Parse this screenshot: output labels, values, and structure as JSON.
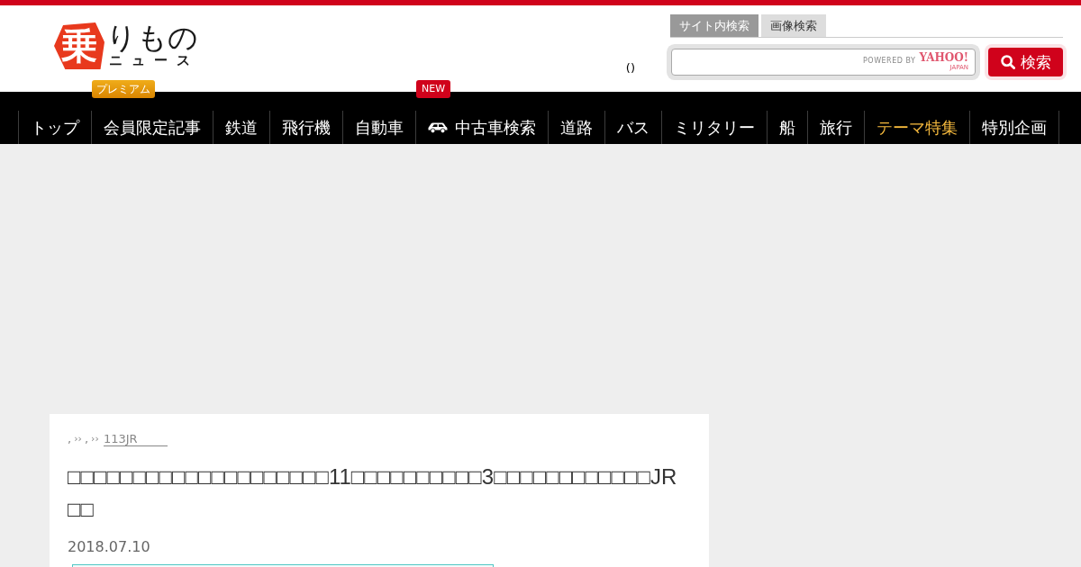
{
  "header": {
    "logo": {
      "emblem": "乗",
      "wordmark": "りもの",
      "subtitle": "ニュース"
    },
    "status_text": "()",
    "search": {
      "tabs": [
        {
          "label": "サイト内検索",
          "selected": true
        },
        {
          "label": "画像検索",
          "selected": false
        }
      ],
      "powered_by": "POWERED BY",
      "provider": "YAHOO!",
      "provider_region": "JAPAN",
      "button": "検索"
    }
  },
  "nav": [
    {
      "label": "トップ",
      "kind": "text",
      "highlighted": false
    },
    {
      "label": "会員限定記事",
      "kind": "text",
      "highlighted": false,
      "badge": {
        "kind": "premium",
        "label": "プレミアム"
      }
    },
    {
      "label": "鉄道",
      "kind": "text",
      "highlighted": false
    },
    {
      "label": "飛行機",
      "kind": "text",
      "highlighted": false
    },
    {
      "label": "自動車",
      "kind": "text",
      "highlighted": false
    },
    {
      "label": "中古車検索",
      "kind": "icon_text",
      "highlighted": false,
      "badge": {
        "kind": "new",
        "label": "NEW"
      }
    },
    {
      "label": "道路",
      "kind": "text",
      "highlighted": false
    },
    {
      "label": "バス",
      "kind": "text",
      "highlighted": false
    },
    {
      "label": "ミリタリー",
      "kind": "text",
      "highlighted": false
    },
    {
      "label": "船",
      "kind": "text",
      "highlighted": false
    },
    {
      "label": "旅行",
      "kind": "text",
      "highlighted": false
    },
    {
      "label": "テーマ特集",
      "kind": "text",
      "highlighted": true
    },
    {
      "label": "特別企画",
      "kind": "text",
      "highlighted": false
    }
  ],
  "article": {
    "breadcrumb": [
      {
        "label": ",",
        "separator": "››"
      },
      {
        "label": ",",
        "separator": "››"
      },
      {
        "label": "113JR"
      }
    ],
    "title": "□□□□□□□□□□□□□□□□□□□□11□□□□□□□□□□3□□□□□□□□□□□□JR□□",
    "date": "2018.07.10"
  }
}
